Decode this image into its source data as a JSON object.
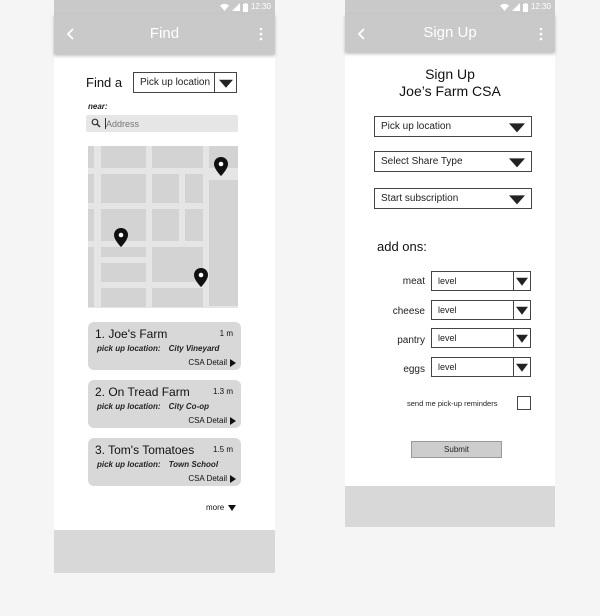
{
  "find_screen": {
    "status_time": "12:30",
    "title": "Find",
    "find_label": "Find a",
    "find_select_value": "Pick up location",
    "near_label": "near:",
    "search_placeholder": "Address",
    "results": [
      {
        "title": "1. Joe's Farm",
        "distance": "1 m",
        "location_label": "pick up location:",
        "location": "City Vineyard",
        "detail_label": "CSA Detail"
      },
      {
        "title": "2. On Tread Farm",
        "distance": "1.3 m",
        "location_label": "pick up location:",
        "location": "City Co-op",
        "detail_label": "CSA Detail"
      },
      {
        "title": "3. Tom's Tomatoes",
        "distance": "1.5 m",
        "location_label": "pick up location:",
        "location": "Town School",
        "detail_label": "CSA Detail"
      }
    ],
    "more_label": "more"
  },
  "signup_screen": {
    "status_time": "12:30",
    "title": "Sign Up",
    "heading_line1": "Sign Up",
    "heading_line2": "Joe’s Farm CSA",
    "selects": [
      "Pick up location",
      "Select Share Type",
      "Start subscription"
    ],
    "addons_label": "add ons:",
    "addons": [
      {
        "name": "meat",
        "value": "level"
      },
      {
        "name": "cheese",
        "value": "level"
      },
      {
        "name": "pantry",
        "value": "level"
      },
      {
        "name": "eggs",
        "value": "level"
      }
    ],
    "reminder_label": "send me pick-up reminders",
    "reminder_checked": false,
    "submit_label": "Submit"
  },
  "icons": {
    "back": "back-arrow-icon",
    "menu": "overflow-menu-icon",
    "search": "search-icon",
    "pin": "map-pin-icon",
    "wifi": "wifi-icon",
    "signal": "signal-icon",
    "battery": "battery-icon"
  },
  "colors": {
    "appbar": "#c9c9c9",
    "card": "#d8d8d8",
    "footer": "#d8d8d8",
    "map_background": "#e5e5e5",
    "map_block": "#d3d3d3"
  }
}
